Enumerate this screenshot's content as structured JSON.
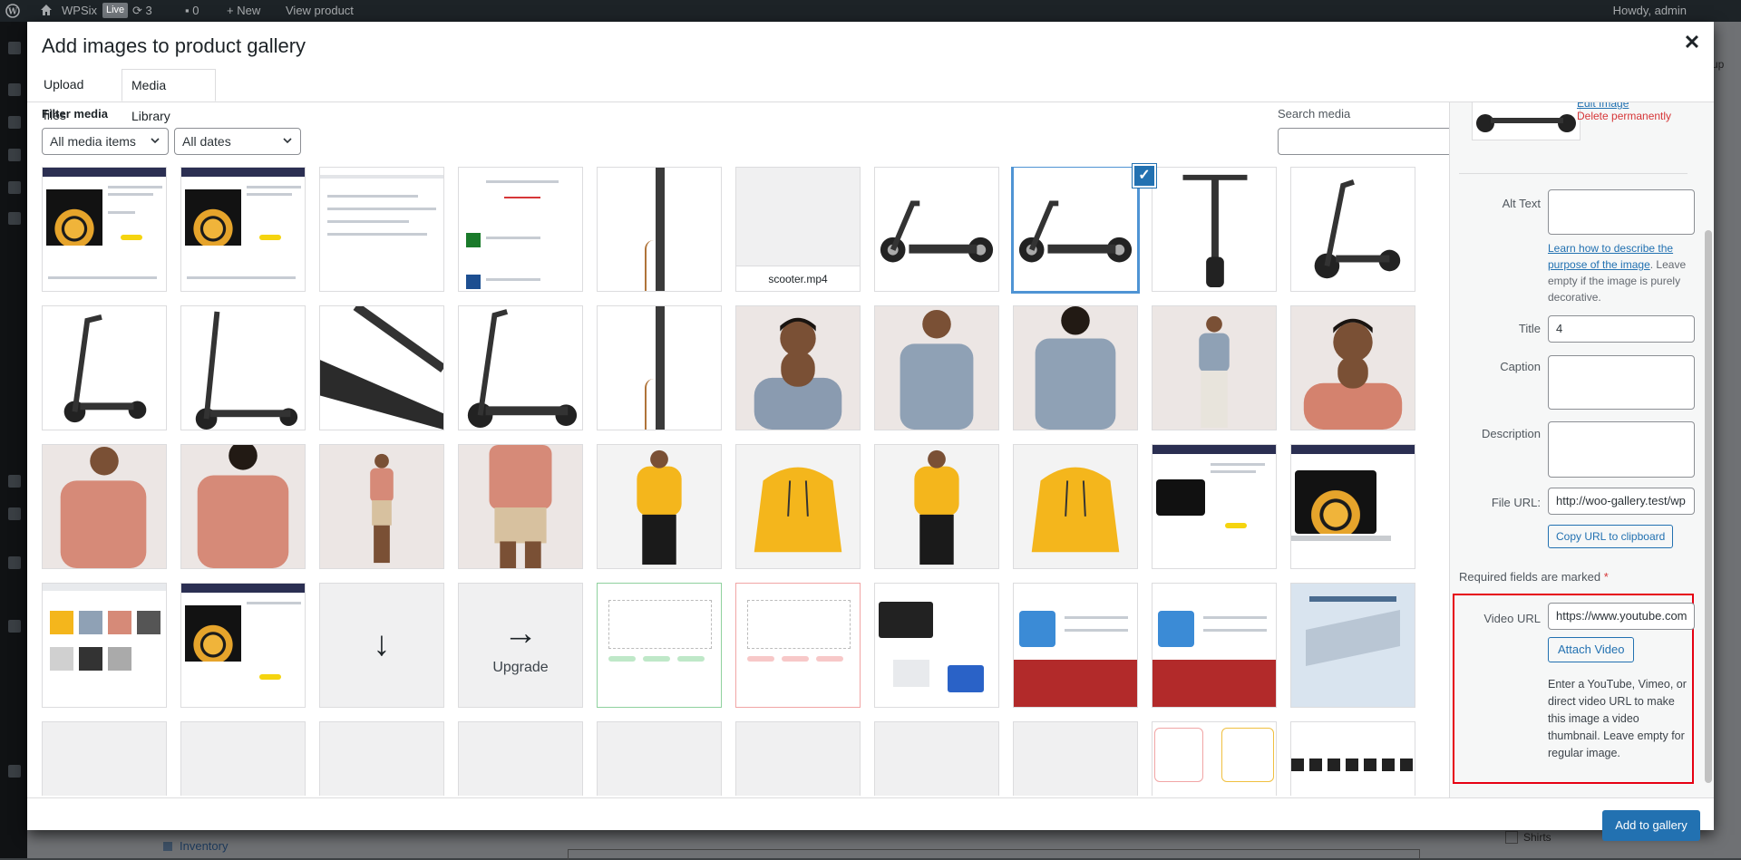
{
  "adminbar": {
    "site_name": "WPSix",
    "live_badge": "Live",
    "updates_count": "3",
    "comments_count": "0",
    "new_label": "New",
    "view_product": "View product",
    "howdy": "Howdy, admin"
  },
  "background": {
    "inventory_label": "Inventory",
    "shirts_label": "Shirts",
    "underp": "up"
  },
  "modal": {
    "title": "Add images to product gallery",
    "close_icon": "close-icon",
    "tabs": [
      {
        "label": "Upload files"
      },
      {
        "label": "Media Library"
      }
    ],
    "filter_label": "Filter media",
    "type_filter": "All media items",
    "date_filter": "All dates",
    "search_label": "Search media",
    "search_value": "",
    "add_button": "Add to gallery"
  },
  "grid": {
    "video_filename": "scooter.mp4",
    "upgrade_label": "Upgrade",
    "selected_index": 7,
    "selected_check": "✓"
  },
  "details": {
    "edit_image": "Edit Image",
    "delete_permanently": "Delete permanently",
    "alt_text_label": "Alt Text",
    "alt_text_value": "",
    "alt_help_link": "Learn how to describe the purpose of the image",
    "alt_help_rest": ". Leave empty if the image is purely decorative.",
    "title_label": "Title",
    "title_value": "4",
    "caption_label": "Caption",
    "caption_value": "",
    "description_label": "Description",
    "description_value": "",
    "file_url_label": "File URL:",
    "file_url_value": "http://woo-gallery.test/wp",
    "copy_url_button": "Copy URL to clipboard",
    "required_note": "Required fields are marked",
    "required_asterisk": "*",
    "video_url_label": "Video URL",
    "video_url_value": "https://www.youtube.com",
    "attach_video_button": "Attach Video",
    "video_help": "Enter a YouTube, Vimeo, or direct video URL to make this image a video thumbnail. Leave empty for regular image."
  },
  "colors": {
    "primary": "#2271b1",
    "highlight_border": "#e60012",
    "danger": "#d63638",
    "selection": "#4f94d4"
  }
}
